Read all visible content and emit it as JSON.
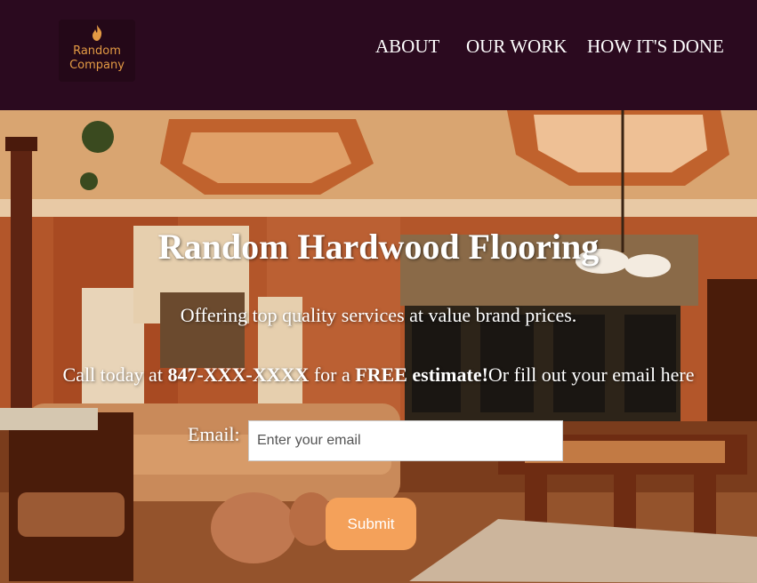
{
  "logo": {
    "line1": "Random",
    "line2": "Company",
    "icon": "flame-icon"
  },
  "nav": {
    "about": "ABOUT",
    "our_work": "OUR WORK",
    "how_its_done": "HOW IT'S DONE"
  },
  "hero": {
    "title": "Random Hardwood Flooring",
    "subtitle": "Offering top quality services at value brand prices.",
    "cta_prefix": "Call today at ",
    "cta_phone": "847-XXX-XXXX",
    "cta_middle": " for a ",
    "cta_free": "FREE estimate!",
    "cta_suffix": "Or fill out your email here"
  },
  "form": {
    "email_label": "Email:",
    "email_placeholder": "Enter your email",
    "email_value": "",
    "submit_label": "Submit"
  },
  "colors": {
    "navbar": "#2b0a1f",
    "logo_text": "#e39a44",
    "button": "#f4a15a"
  }
}
